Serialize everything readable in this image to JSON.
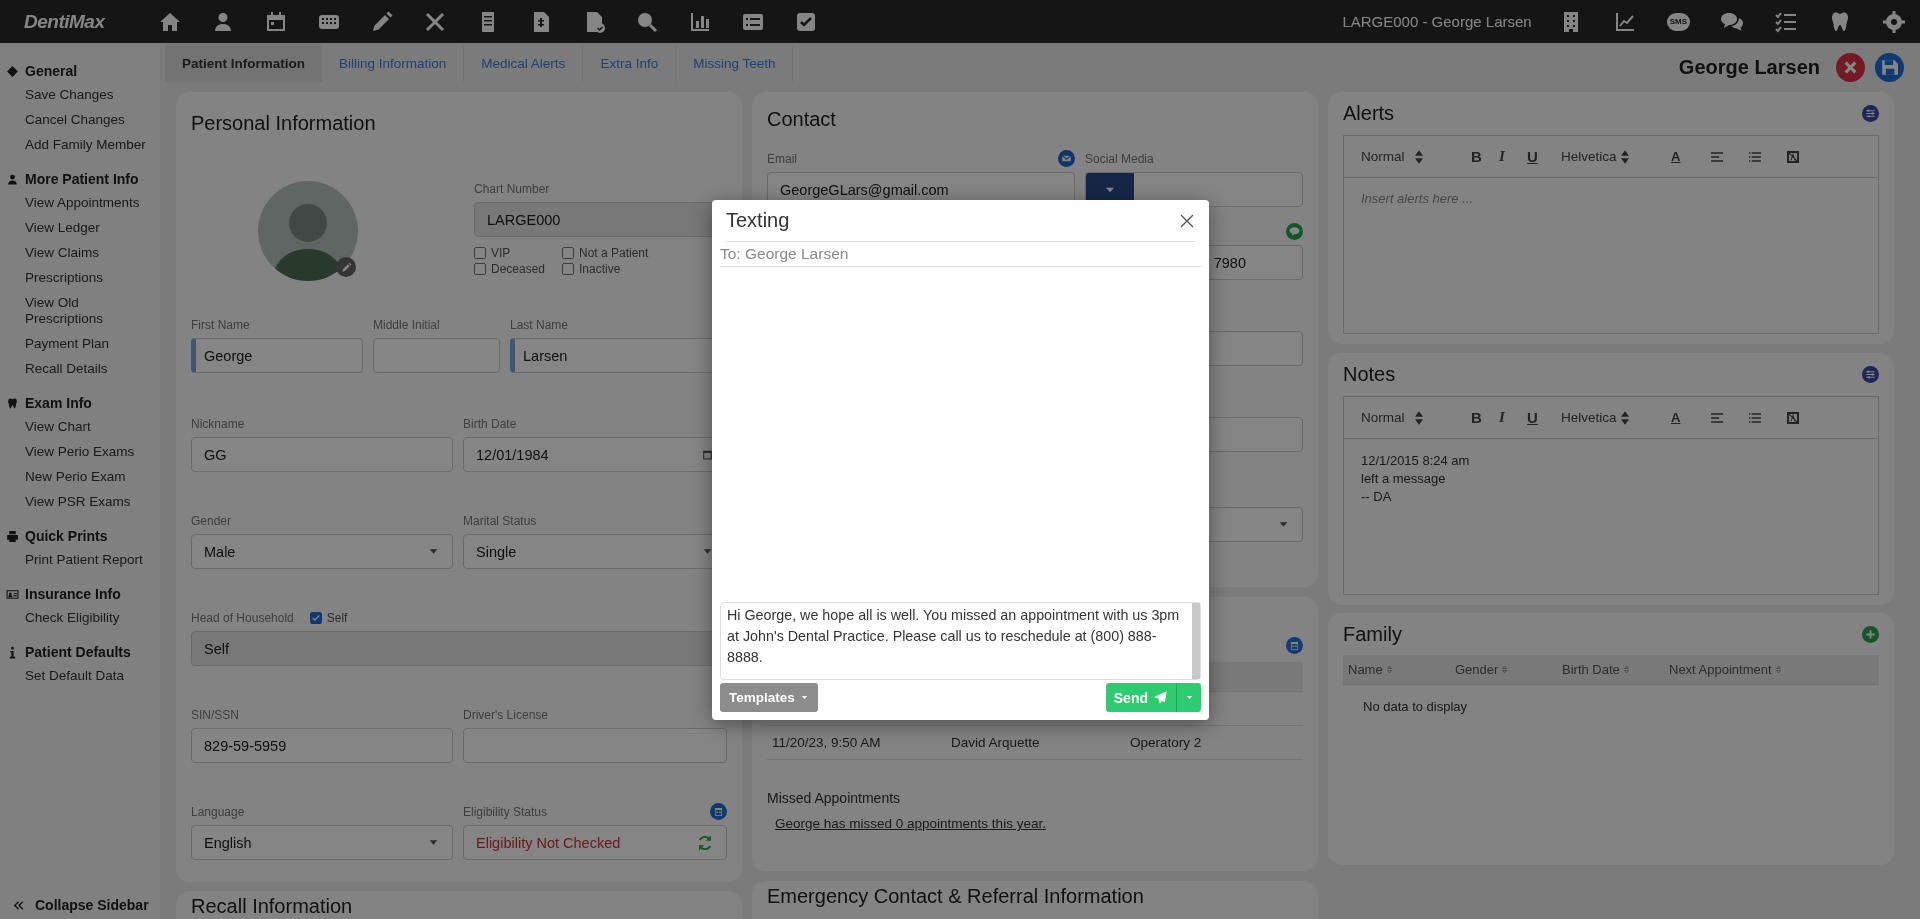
{
  "topbar": {
    "logo": "DentiMax",
    "patient": "LARGE000 - George Larsen",
    "sms_badge": "SMS"
  },
  "sidebar": {
    "sections": [
      {
        "title": "General",
        "items": [
          "Save Changes",
          "Cancel Changes",
          "Add Family Member"
        ]
      },
      {
        "title": "More Patient Info",
        "items": [
          "View Appointments",
          "View Ledger",
          "View Claims",
          "Prescriptions",
          "View Old Prescriptions",
          "Payment Plan",
          "Recall Details"
        ]
      },
      {
        "title": "Exam Info",
        "items": [
          "View Chart",
          "View Perio Exams",
          "New Perio Exam",
          "View PSR Exams"
        ]
      },
      {
        "title": "Quick Prints",
        "items": [
          "Print Patient Report"
        ]
      },
      {
        "title": "Insurance Info",
        "items": [
          "Check Eligibility"
        ]
      },
      {
        "title": "Patient Defaults",
        "items": [
          "Set Default Data"
        ]
      }
    ],
    "collapse": "Collapse Sidebar"
  },
  "tabs": [
    {
      "label": "Patient Information",
      "selected": true
    },
    {
      "label": "Billing Information",
      "selected": false
    },
    {
      "label": "Medical Alerts",
      "selected": false
    },
    {
      "label": "Extra Info",
      "selected": false
    },
    {
      "label": "Missing Teeth",
      "selected": false
    }
  ],
  "patient_name": "George Larsen",
  "personal": {
    "title": "Personal Information",
    "chart_number": {
      "label": "Chart Number",
      "value": "LARGE000"
    },
    "flags": [
      {
        "label": "VIP",
        "checked": false
      },
      {
        "label": "Not a Patient",
        "checked": false
      },
      {
        "label": "Deceased",
        "checked": false
      },
      {
        "label": "Inactive",
        "checked": false
      }
    ],
    "names": [
      {
        "label": "First Name",
        "value": "George",
        "required": true
      },
      {
        "label": "Middle Initial",
        "required": false
      },
      {
        "label": "Last Name",
        "value": "Larsen",
        "required": true
      }
    ],
    "fields": [
      {
        "kind": "text",
        "label": "Nickname",
        "value": "GG"
      },
      {
        "kind": "date",
        "label": "Birth Date",
        "value": "12/01/1984"
      },
      {
        "kind": "select",
        "label": "Gender",
        "value": "Male"
      },
      {
        "kind": "select",
        "label": "Marital Status",
        "value": "Single"
      },
      {
        "kind": "household",
        "label": "Head of Household",
        "check_label": "Self",
        "checked": true,
        "value": "Self"
      },
      {
        "kind": "text",
        "label": "SIN/SSN",
        "value": "829-59-5959"
      },
      {
        "kind": "text",
        "label": "Driver's License"
      },
      {
        "kind": "select",
        "label": "Language",
        "value": "English"
      },
      {
        "kind": "status",
        "label": "Eligibility Status",
        "value": "Eligibility Not Checked"
      }
    ]
  },
  "contact": {
    "title": "Contact",
    "email_label": "Email",
    "email": "GeorgeGLars@gmail.com",
    "social_label": "Social Media",
    "phone": "7980"
  },
  "appointments": {
    "rows": [
      {
        "cells": [
          "11/20/23, 9:50 AM",
          "David Arquette",
          "Operatory 2"
        ]
      }
    ],
    "missed_title": "Missed Appointments",
    "missed_link": "George has missed 0 appointments this year."
  },
  "alerts": {
    "title": "Alerts",
    "style": "Normal",
    "font": "Helvetica",
    "format_buttons": [
      "B",
      "I",
      "U"
    ],
    "color_button": "A",
    "placeholder": "Insert alerts here ..."
  },
  "notes": {
    "title": "Notes",
    "style": "Normal",
    "font": "Helvetica",
    "format_buttons": [
      "B",
      "I",
      "U"
    ],
    "color_button": "A",
    "lines": [
      "12/1/2015 8:24 am",
      "left a message",
      "-- DA"
    ]
  },
  "family": {
    "title": "Family",
    "columns": [
      "Name",
      "Gender",
      "Birth Date",
      "Next Appointment"
    ],
    "empty": "No data to display"
  },
  "recall_title": "Recall Information",
  "emergency_title": "Emergency Contact & Referral Information",
  "modal": {
    "title": "Texting",
    "to": "To: George Larsen",
    "message": "Hi George, we hope all is well. You missed an appointment with us 3pm at John's Dental Practice. Please call us to reschedule at (800) 888-8888.",
    "templates": "Templates",
    "send": "Send"
  }
}
